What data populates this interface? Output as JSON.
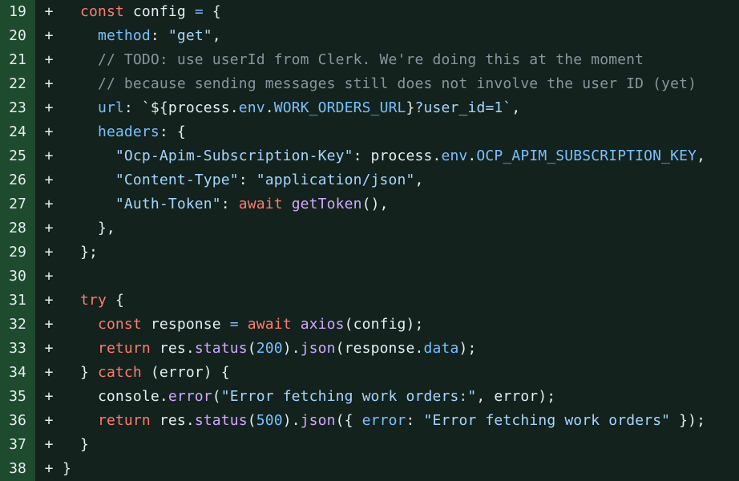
{
  "diff": {
    "add_sign": "+",
    "lines": [
      {
        "num": "19",
        "tokens": [
          {
            "t": "  ",
            "k": "plain"
          },
          {
            "t": "const",
            "k": "kw"
          },
          {
            "t": " config ",
            "k": "plain"
          },
          {
            "t": "=",
            "k": "prop"
          },
          {
            "t": " {",
            "k": "plain"
          }
        ]
      },
      {
        "num": "20",
        "tokens": [
          {
            "t": "    ",
            "k": "plain"
          },
          {
            "t": "method",
            "k": "prop"
          },
          {
            "t": ": ",
            "k": "plain"
          },
          {
            "t": "\"get\"",
            "k": "str"
          },
          {
            "t": ",",
            "k": "plain"
          }
        ]
      },
      {
        "num": "21",
        "tokens": [
          {
            "t": "    ",
            "k": "plain"
          },
          {
            "t": "// TODO: use userId from Clerk. We're doing this at the moment",
            "k": "com"
          }
        ]
      },
      {
        "num": "22",
        "tokens": [
          {
            "t": "    ",
            "k": "plain"
          },
          {
            "t": "// because sending messages still does not involve the user ID (yet)",
            "k": "com"
          }
        ]
      },
      {
        "num": "23",
        "tokens": [
          {
            "t": "    ",
            "k": "plain"
          },
          {
            "t": "url",
            "k": "prop"
          },
          {
            "t": ": `${process.",
            "k": "plain"
          },
          {
            "t": "env",
            "k": "prop"
          },
          {
            "t": ".",
            "k": "plain"
          },
          {
            "t": "WORK_ORDERS_URL",
            "k": "prop"
          },
          {
            "t": "}",
            "k": "plain"
          },
          {
            "t": "?user_id=1`",
            "k": "str"
          },
          {
            "t": ",",
            "k": "plain"
          }
        ]
      },
      {
        "num": "24",
        "tokens": [
          {
            "t": "    ",
            "k": "plain"
          },
          {
            "t": "headers",
            "k": "prop"
          },
          {
            "t": ": {",
            "k": "plain"
          }
        ]
      },
      {
        "num": "25",
        "tokens": [
          {
            "t": "      ",
            "k": "plain"
          },
          {
            "t": "\"Ocp-Apim-Subscription-Key\"",
            "k": "str"
          },
          {
            "t": ": process.",
            "k": "plain"
          },
          {
            "t": "env",
            "k": "prop"
          },
          {
            "t": ".",
            "k": "plain"
          },
          {
            "t": "OCP_APIM_SUBSCRIPTION_KEY",
            "k": "prop"
          },
          {
            "t": ",",
            "k": "plain"
          }
        ]
      },
      {
        "num": "26",
        "tokens": [
          {
            "t": "      ",
            "k": "plain"
          },
          {
            "t": "\"Content-Type\"",
            "k": "str"
          },
          {
            "t": ": ",
            "k": "plain"
          },
          {
            "t": "\"application/json\"",
            "k": "str"
          },
          {
            "t": ",",
            "k": "plain"
          }
        ]
      },
      {
        "num": "27",
        "tokens": [
          {
            "t": "      ",
            "k": "plain"
          },
          {
            "t": "\"Auth-Token\"",
            "k": "str"
          },
          {
            "t": ": ",
            "k": "plain"
          },
          {
            "t": "await",
            "k": "kw"
          },
          {
            "t": " ",
            "k": "plain"
          },
          {
            "t": "getToken",
            "k": "fn"
          },
          {
            "t": "(),",
            "k": "plain"
          }
        ]
      },
      {
        "num": "28",
        "tokens": [
          {
            "t": "    },",
            "k": "plain"
          }
        ]
      },
      {
        "num": "29",
        "tokens": [
          {
            "t": "  };",
            "k": "plain"
          }
        ]
      },
      {
        "num": "30",
        "tokens": []
      },
      {
        "num": "31",
        "tokens": [
          {
            "t": "  ",
            "k": "plain"
          },
          {
            "t": "try",
            "k": "kw"
          },
          {
            "t": " {",
            "k": "plain"
          }
        ]
      },
      {
        "num": "32",
        "tokens": [
          {
            "t": "    ",
            "k": "plain"
          },
          {
            "t": "const",
            "k": "kw"
          },
          {
            "t": " response ",
            "k": "plain"
          },
          {
            "t": "=",
            "k": "prop"
          },
          {
            "t": " ",
            "k": "plain"
          },
          {
            "t": "await",
            "k": "kw"
          },
          {
            "t": " ",
            "k": "plain"
          },
          {
            "t": "axios",
            "k": "fn"
          },
          {
            "t": "(config);",
            "k": "plain"
          }
        ]
      },
      {
        "num": "33",
        "tokens": [
          {
            "t": "    ",
            "k": "plain"
          },
          {
            "t": "return",
            "k": "kw"
          },
          {
            "t": " res.",
            "k": "plain"
          },
          {
            "t": "status",
            "k": "fn"
          },
          {
            "t": "(",
            "k": "plain"
          },
          {
            "t": "200",
            "k": "num"
          },
          {
            "t": ").",
            "k": "plain"
          },
          {
            "t": "json",
            "k": "fn"
          },
          {
            "t": "(response.",
            "k": "plain"
          },
          {
            "t": "data",
            "k": "prop"
          },
          {
            "t": ");",
            "k": "plain"
          }
        ]
      },
      {
        "num": "34",
        "tokens": [
          {
            "t": "  } ",
            "k": "plain"
          },
          {
            "t": "catch",
            "k": "kw"
          },
          {
            "t": " (error) {",
            "k": "plain"
          }
        ]
      },
      {
        "num": "35",
        "tokens": [
          {
            "t": "    console.",
            "k": "plain"
          },
          {
            "t": "error",
            "k": "fn"
          },
          {
            "t": "(",
            "k": "plain"
          },
          {
            "t": "\"Error fetching work orders:\"",
            "k": "str"
          },
          {
            "t": ", error);",
            "k": "plain"
          }
        ]
      },
      {
        "num": "36",
        "tokens": [
          {
            "t": "    ",
            "k": "plain"
          },
          {
            "t": "return",
            "k": "kw"
          },
          {
            "t": " res.",
            "k": "plain"
          },
          {
            "t": "status",
            "k": "fn"
          },
          {
            "t": "(",
            "k": "plain"
          },
          {
            "t": "500",
            "k": "num"
          },
          {
            "t": ").",
            "k": "plain"
          },
          {
            "t": "json",
            "k": "fn"
          },
          {
            "t": "({ ",
            "k": "plain"
          },
          {
            "t": "error",
            "k": "prop"
          },
          {
            "t": ": ",
            "k": "plain"
          },
          {
            "t": "\"Error fetching work orders\"",
            "k": "str"
          },
          {
            "t": " });",
            "k": "plain"
          }
        ]
      },
      {
        "num": "37",
        "tokens": [
          {
            "t": "  }",
            "k": "plain"
          }
        ]
      },
      {
        "num": "38",
        "tokens": [
          {
            "t": "}",
            "k": "plain"
          }
        ]
      }
    ]
  },
  "colors": {
    "background": "#13221d",
    "gutter": "#1e4a2e",
    "keyword": "#ff7b72",
    "property": "#79c0ff",
    "string": "#a5d6ff",
    "function": "#d2a8ff",
    "comment": "#8b949e",
    "text": "#e6edf3"
  }
}
